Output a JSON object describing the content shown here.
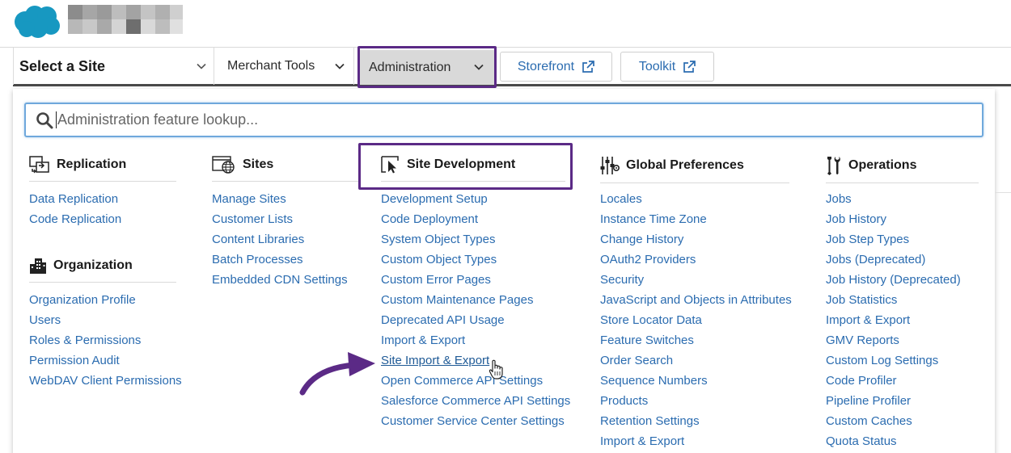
{
  "header": {
    "logo": "salesforce-cloud-logo"
  },
  "nav": {
    "site_select": "Select a Site",
    "merchant_tools": "Merchant Tools",
    "administration": "Administration",
    "storefront": "Storefront",
    "toolkit": "Toolkit"
  },
  "search": {
    "placeholder": "Administration feature lookup..."
  },
  "sections": {
    "replication": {
      "title": "Replication",
      "items": [
        "Data Replication",
        "Code Replication"
      ]
    },
    "organization": {
      "title": "Organization",
      "items": [
        "Organization Profile",
        "Users",
        "Roles & Permissions",
        "Permission Audit",
        "WebDAV Client Permissions"
      ]
    },
    "sites": {
      "title": "Sites",
      "items": [
        "Manage Sites",
        "Customer Lists",
        "Content Libraries",
        "Batch Processes",
        "Embedded CDN Settings"
      ]
    },
    "site_development": {
      "title": "Site Development",
      "items": [
        "Development Setup",
        "Code Deployment",
        "System Object Types",
        "Custom Object Types",
        "Custom Error Pages",
        "Custom Maintenance Pages",
        "Deprecated API Usage",
        "Import & Export",
        "Site Import & Export",
        "Open Commerce API Settings",
        "Salesforce Commerce API Settings",
        "Customer Service Center Settings"
      ]
    },
    "global_preferences": {
      "title": "Global Preferences",
      "items": [
        "Locales",
        "Instance Time Zone",
        "Change History",
        "OAuth2 Providers",
        "Security",
        "JavaScript and Objects in Attributes",
        "Store Locator Data",
        "Feature Switches",
        "Order Search",
        "Sequence Numbers",
        "Products",
        "Retention Settings",
        "Import & Export"
      ]
    },
    "operations": {
      "title": "Operations",
      "items": [
        "Jobs",
        "Job History",
        "Job Step Types",
        "Jobs (Deprecated)",
        "Job History (Deprecated)",
        "Job Statistics",
        "Import & Export",
        "GMV Reports",
        "Custom Log Settings",
        "Code Profiler",
        "Pipeline Profiler",
        "Custom Caches",
        "Quota Status"
      ]
    }
  },
  "colors": {
    "link": "#2b6cb0",
    "highlight": "#5b2a86",
    "search_border": "#6fa8dc"
  }
}
